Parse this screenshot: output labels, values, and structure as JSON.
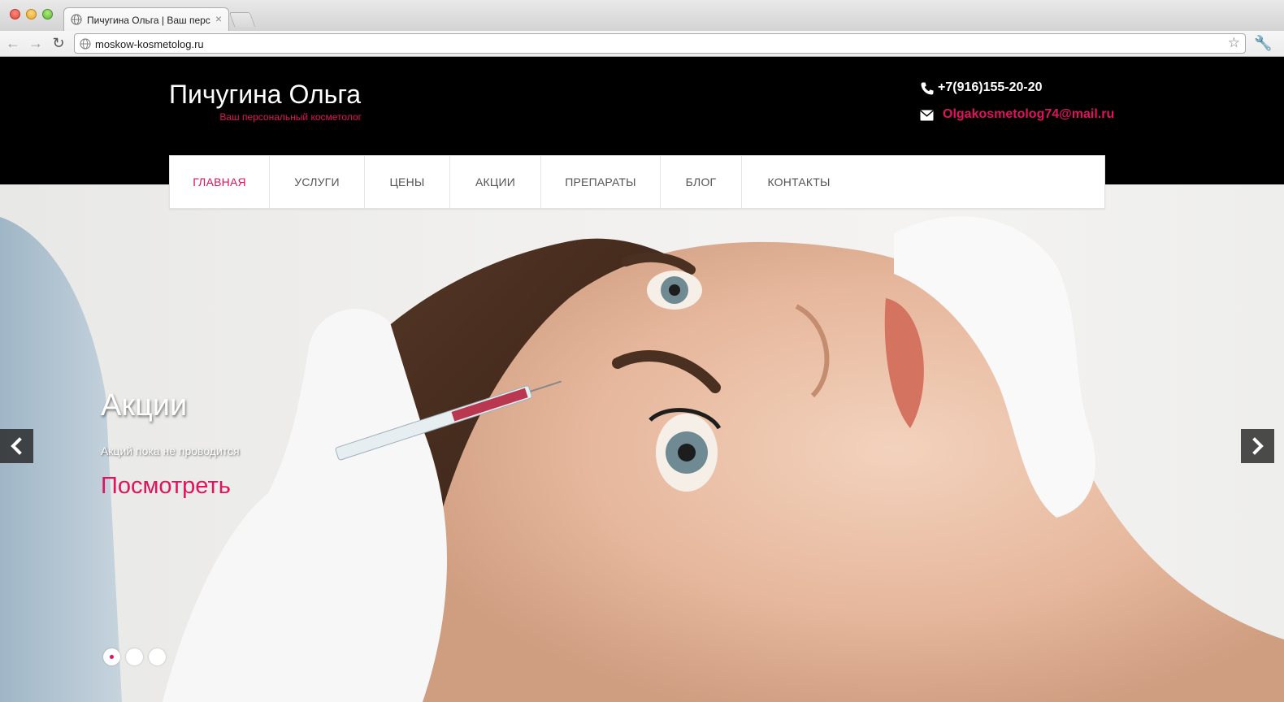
{
  "browser": {
    "tab_title": "Пичугина Ольга | Ваш персо",
    "tab_close": "×",
    "url": "moskow-kosmetolog.ru",
    "back_glyph": "←",
    "forward_glyph": "→",
    "reload_glyph": "↻",
    "star_glyph": "☆",
    "wrench_glyph": "🔧"
  },
  "header": {
    "site_name": "Пичугина Ольга",
    "tagline": "Ваш персональный косметолог",
    "phone": "+7(916)155-20-20",
    "email": "Olgakosmetolog74@mail.ru"
  },
  "nav": {
    "items": [
      {
        "label": "ГЛАВНАЯ",
        "active": true
      },
      {
        "label": "УСЛУГИ"
      },
      {
        "label": "ЦЕНЫ"
      },
      {
        "label": "АКЦИИ"
      },
      {
        "label": "ПРЕПАРАТЫ"
      },
      {
        "label": "БЛОГ"
      },
      {
        "label": "КОНТАКТЫ"
      }
    ]
  },
  "slider": {
    "title": "Акции",
    "text": "Акций пока не проводится",
    "link": "Посмотреть",
    "dots_count": 3,
    "active_dot": 1
  },
  "colors": {
    "accent": "#e0135c",
    "header_bg": "#000000",
    "nav_bg": "#ffffff"
  },
  "icons": [
    "globe-icon",
    "phone-icon",
    "envelope-icon",
    "chevron-left-icon",
    "chevron-right-icon",
    "star-icon",
    "wrench-icon"
  ]
}
